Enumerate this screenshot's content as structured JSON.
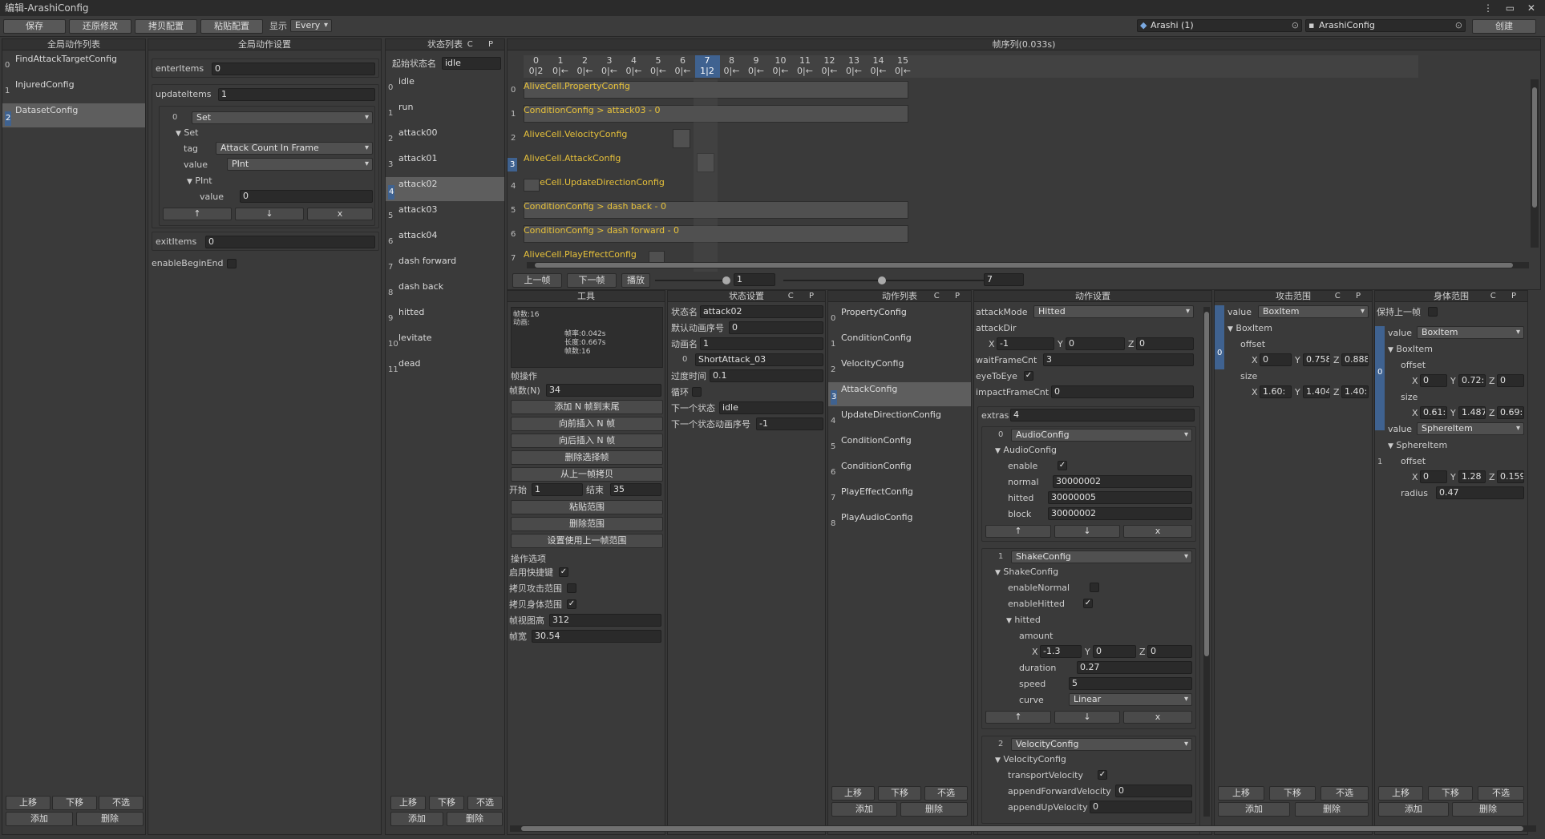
{
  "window": {
    "title": "编辑-ArashiConfig",
    "controls": "⋮ ▭ ✕"
  },
  "toolbar": {
    "save": "保存",
    "revert": "还原修改",
    "copy": "拷贝配置",
    "paste": "粘贴配置",
    "show_label": "显示",
    "show_value": "Every",
    "target1": "Arashi (1)",
    "target2": "ArashiConfig",
    "create": "创建"
  },
  "global_actions": {
    "title": "全局动作列表",
    "items": [
      {
        "i": "0",
        "label": "FindAttackTargetConfig"
      },
      {
        "i": "1",
        "label": "InjuredConfig"
      },
      {
        "i": "2",
        "label": "DatasetConfig"
      }
    ],
    "up": "上移",
    "down": "下移",
    "deselect": "不选",
    "add": "添加",
    "delete": "删除"
  },
  "global_settings": {
    "title": "全局动作设置",
    "enter_label": "enterItems",
    "enter_value": "0",
    "update_label": "updateItems",
    "update_value": "1",
    "row_idx": "0",
    "set_dd": "Set",
    "set_label": "Set",
    "tag_label": "tag",
    "tag_value": "Attack Count In Frame",
    "value_label": "value",
    "value_value": "PInt",
    "pint_label": "PInt",
    "pint_value_label": "value",
    "pint_value": "0",
    "up": "↑",
    "down": "↓",
    "x": "x",
    "exit_label": "exitItems",
    "exit_value": "0",
    "begin_label": "enableBeginEnd"
  },
  "states": {
    "title": "状态列表",
    "cp": "C P",
    "start_label": "起始状态名",
    "start_value": "idle",
    "items": [
      {
        "i": "0",
        "label": "idle"
      },
      {
        "i": "1",
        "label": "run"
      },
      {
        "i": "2",
        "label": "attack00"
      },
      {
        "i": "3",
        "label": "attack01"
      },
      {
        "i": "4",
        "label": "attack02"
      },
      {
        "i": "5",
        "label": "attack03"
      },
      {
        "i": "6",
        "label": "attack04"
      },
      {
        "i": "7",
        "label": "dash forward"
      },
      {
        "i": "8",
        "label": "dash back"
      },
      {
        "i": "9",
        "label": "hitted"
      },
      {
        "i": "10",
        "label": "levitate"
      },
      {
        "i": "11",
        "label": "dead"
      }
    ],
    "up": "上移",
    "down": "下移",
    "deselect": "不选",
    "add": "添加",
    "delete": "删除"
  },
  "timeline": {
    "title": "帧序列(0.033s)",
    "frames": [
      {
        "n": "0",
        "s": "0|2"
      },
      {
        "n": "1",
        "s": "0|←"
      },
      {
        "n": "2",
        "s": "0|←"
      },
      {
        "n": "3",
        "s": "0|←"
      },
      {
        "n": "4",
        "s": "0|←"
      },
      {
        "n": "5",
        "s": "0|←"
      },
      {
        "n": "6",
        "s": "0|←"
      },
      {
        "n": "7",
        "s": "1|2"
      },
      {
        "n": "8",
        "s": "0|←"
      },
      {
        "n": "9",
        "s": "0|←"
      },
      {
        "n": "10",
        "s": "0|←"
      },
      {
        "n": "11",
        "s": "0|←"
      },
      {
        "n": "12",
        "s": "0|←"
      },
      {
        "n": "13",
        "s": "0|←"
      },
      {
        "n": "14",
        "s": "0|←"
      },
      {
        "n": "15",
        "s": "0|←"
      }
    ],
    "rows": [
      {
        "i": "0",
        "label": "AliveCell.PropertyConfig"
      },
      {
        "i": "1",
        "label": "ConditionConfig > attack03 - 0"
      },
      {
        "i": "2",
        "label": "AliveCell.VelocityConfig"
      },
      {
        "i": "3",
        "label": "AliveCell.AttackConfig"
      },
      {
        "i": "4",
        "label": "AliveCell.UpdateDirectionConfig"
      },
      {
        "i": "5",
        "label": "ConditionConfig > dash back - 0"
      },
      {
        "i": "6",
        "label": "ConditionConfig > dash forward - 0"
      },
      {
        "i": "7",
        "label": "AliveCell.PlayEffectConfig"
      }
    ],
    "prev": "上一帧",
    "next": "下一帧",
    "play": "播放",
    "frame_value": "1",
    "end_value": "7"
  },
  "tools": {
    "title": "工具",
    "info1": "帧数:16",
    "info2": "动画:",
    "info3": "帧率:0.042s",
    "info4": "长度:0.667s",
    "info5": "帧数:16",
    "ops": "帧操作",
    "n_label": "帧数(N)",
    "n_value": "34",
    "b1": "添加 N 帧到末尾",
    "b2": "向前插入 N 帧",
    "b3": "向后插入 N 帧",
    "b4": "删除选择帧",
    "b5": "从上一帧拷贝",
    "start_label": "开始",
    "start_value": "1",
    "end_label": "结束",
    "end_value": "35",
    "b6": "粘贴范围",
    "b7": "删除范围",
    "b8": "设置使用上一帧范围",
    "options": "操作选项",
    "o1": "启用快捷键",
    "o2": "拷贝攻击范围",
    "o3": "拷贝身体范围",
    "h_label": "帧视图高",
    "h_value": "312",
    "w_label": "帧宽",
    "w_value": "30.54"
  },
  "state_settings": {
    "title": "状态设置",
    "cp": "C P",
    "name_label": "状态名",
    "name_value": "attack02",
    "anim_idx_label": "默认动画序号",
    "anim_idx_value": "0",
    "anim_label": "动画名",
    "anim_value": "1",
    "anim_row_idx": "0",
    "anim_row_value": "ShortAttack_03",
    "trans_label": "过度时间",
    "trans_value": "0.1",
    "loop_label": "循环",
    "next_label": "下一个状态",
    "next_value": "idle",
    "next_anim_label": "下一个状态动画序号",
    "next_anim_value": "-1"
  },
  "actions": {
    "title": "动作列表",
    "cp": "C P",
    "items": [
      {
        "i": "0",
        "label": "PropertyConfig"
      },
      {
        "i": "1",
        "label": "ConditionConfig"
      },
      {
        "i": "2",
        "label": "VelocityConfig"
      },
      {
        "i": "3",
        "label": "AttackConfig"
      },
      {
        "i": "4",
        "label": "UpdateDirectionConfig"
      },
      {
        "i": "5",
        "label": "ConditionConfig"
      },
      {
        "i": "6",
        "label": "ConditionConfig"
      },
      {
        "i": "7",
        "label": "PlayEffectConfig"
      },
      {
        "i": "8",
        "label": "PlayAudioConfig"
      }
    ],
    "up": "上移",
    "down": "下移",
    "deselect": "不选",
    "add": "添加",
    "delete": "删除"
  },
  "action_settings": {
    "title": "动作设置",
    "mode_label": "attackMode",
    "mode_value": "Hitted",
    "dir_label": "attackDir",
    "dir_x": "-1",
    "dir_y": "0",
    "dir_z": "0",
    "wait_label": "waitFrameCnt",
    "wait_value": "3",
    "eye_label": "eyeToEye",
    "impact_label": "impactFrameCnt",
    "impact_value": "0",
    "extras_label": "extras",
    "extras_value": "4",
    "e0_idx": "0",
    "e0_dd": "AudioConfig",
    "e0_title": "AudioConfig",
    "enable_label": "enable",
    "normal_label": "normal",
    "normal_value": "30000002",
    "hitted_label": "hitted",
    "hitted_value": "30000005",
    "block_label": "block",
    "block_value": "30000002",
    "e1_idx": "1",
    "e1_dd": "ShakeConfig",
    "e1_title": "ShakeConfig",
    "en_normal": "enableNormal",
    "en_hitted": "enableHitted",
    "hitted_title": "hitted",
    "amount_label": "amount",
    "am_x": "-1.3",
    "am_y": "0",
    "am_z": "0",
    "dur_label": "duration",
    "dur_value": "0.27",
    "speed_label": "speed",
    "speed_value": "5",
    "curve_label": "curve",
    "curve_value": "Linear",
    "e2_idx": "2",
    "e2_dd": "VelocityConfig",
    "e2_title": "VelocityConfig",
    "tv_label": "transportVelocity",
    "afv_label": "appendForwardVelocity",
    "afv_value": "0",
    "auv_label": "appendUpVelocity",
    "auv_value": "0",
    "up": "↑",
    "down": "↓",
    "x": "x",
    "X": "X",
    "Y": "Y",
    "Z": "Z"
  },
  "attack_range": {
    "title": "攻击范围",
    "cp": "C P",
    "value_label": "value",
    "value_value": "BoxItem",
    "idx": "0",
    "box_title": "BoxItem",
    "offset_label": "offset",
    "off_x": "0",
    "off_y": "0.758",
    "off_z": "0.888",
    "size_label": "size",
    "size_x": "1.60:",
    "size_y": "1.404",
    "size_z": "1.40:",
    "up": "上移",
    "down": "下移",
    "deselect": "不选",
    "add": "添加",
    "delete": "删除"
  },
  "body_range": {
    "title": "身体范围",
    "cp": "C P",
    "keep_label": "保持上一帧",
    "v0_label": "value",
    "v0_value": "BoxItem",
    "idx0": "0",
    "box_title": "BoxItem",
    "offset_label": "offset",
    "b_off_x": "0",
    "b_off_y": "0.72:",
    "b_off_z": "0",
    "size_label": "size",
    "b_size_x": "0.61:",
    "b_size_y": "1.487",
    "b_size_z": "0.69:",
    "v1_label": "value",
    "v1_value": "SphereItem",
    "idx1": "1",
    "sphere_title": "SphereItem",
    "s_offset_label": "offset",
    "s_off_x": "0",
    "s_off_y": "1.28",
    "s_off_z": "0.159",
    "radius_label": "radius",
    "radius_value": "0.47",
    "up": "上移",
    "down": "下移",
    "deselect": "不选",
    "add": "添加",
    "delete": "删除"
  }
}
